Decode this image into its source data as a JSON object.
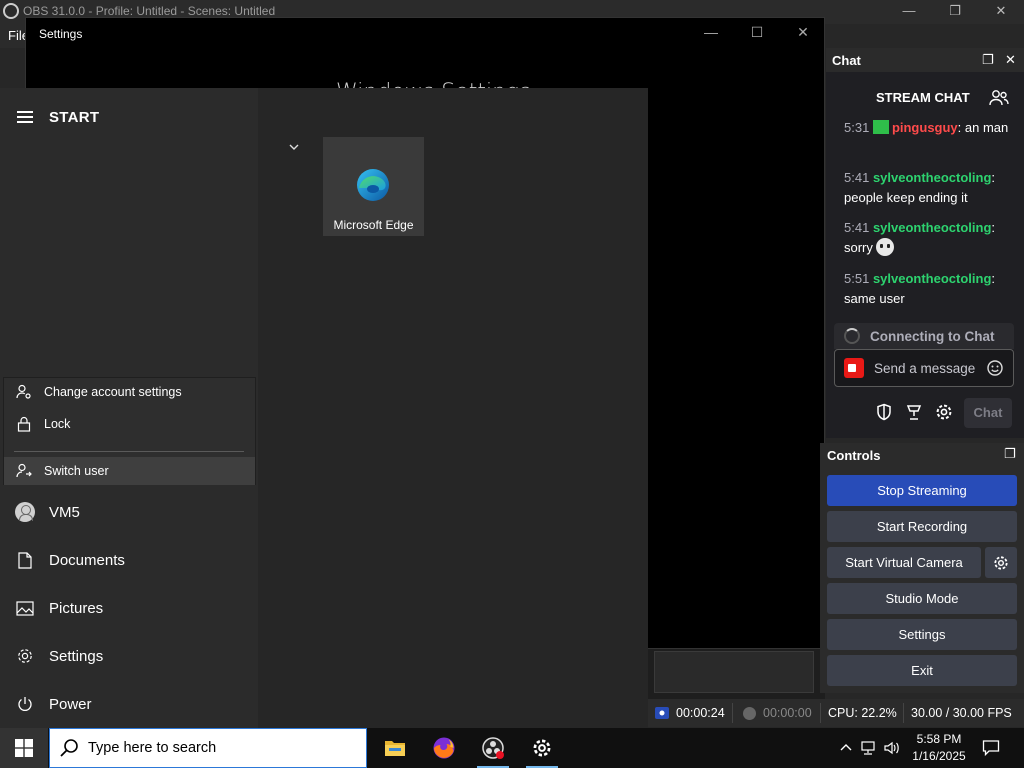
{
  "obs": {
    "title": "OBS 31.0.0 - Profile: Untitled - Scenes: Untitled",
    "menu_file": "File"
  },
  "settings_window": {
    "title": "Settings",
    "heading": "Windows Settings"
  },
  "start_menu": {
    "label": "START",
    "account_popup": {
      "change_account": "Change account settings",
      "lock": "Lock",
      "switch_user": "Switch user"
    },
    "nav": {
      "user": "VM5",
      "documents": "Documents",
      "pictures": "Pictures",
      "settings": "Settings",
      "power": "Power"
    },
    "tile_edge": "Microsoft Edge"
  },
  "chat": {
    "dock_title": "Chat",
    "stream_chat_title": "STREAM CHAT",
    "messages": [
      {
        "time": "5:31",
        "user": "pingusguy",
        "sep": ":",
        "text": " an man",
        "color": "#ff4b4b"
      },
      {
        "time": "5:41",
        "user": "sylveontheoctoling",
        "sep": ":",
        "text": "people keep ending it",
        "color": "#2dd36f"
      },
      {
        "time": "5:41",
        "user": "sylveontheoctoling",
        "sep": ":",
        "text": "sorry",
        "color": "#2dd36f"
      },
      {
        "time": "5:51",
        "user": "sylveontheoctoling",
        "sep": ":",
        "text": "same user",
        "color": "#2dd36f"
      }
    ],
    "connecting": "Connecting to Chat",
    "send_placeholder": "Send a message",
    "chat_button": "Chat"
  },
  "controls": {
    "title": "Controls",
    "stop_streaming": "Stop Streaming",
    "start_recording": "Start Recording",
    "start_virtual_camera": "Start Virtual Camera",
    "studio_mode": "Studio Mode",
    "settings": "Settings",
    "exit": "Exit"
  },
  "status": {
    "stream_time": "00:00:24",
    "record_time": "00:00:00",
    "cpu": "CPU: 22.2%",
    "fps": "30.00 / 30.00 FPS"
  },
  "taskbar": {
    "search_placeholder": "Type here to search",
    "time": "5:58 PM",
    "date": "1/16/2025"
  },
  "colors": {
    "accent_blue": "#284cb8",
    "user_red": "#ff4b4b",
    "user_green": "#2dd36f",
    "taskbar_highlight": "#76b9ed"
  }
}
